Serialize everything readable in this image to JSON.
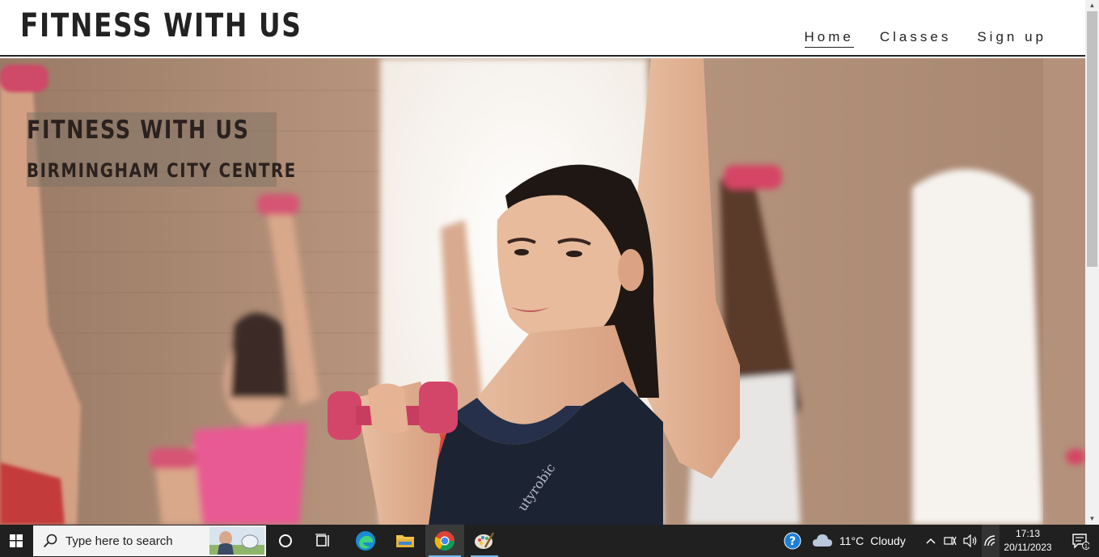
{
  "site": {
    "brand": "FITNESS WITH US",
    "nav": [
      {
        "label": "Home",
        "active": true
      },
      {
        "label": "Classes",
        "active": false
      },
      {
        "label": "Sign up",
        "active": false
      }
    ]
  },
  "hero": {
    "title": "FITNESS WITH US",
    "subtitle": "BIRMINGHAM CITY CENTRE",
    "image": "women-lifting-pink-dumbbells-in-gym-class"
  },
  "taskbar": {
    "search_placeholder": "Type here to search",
    "apps": [
      {
        "name": "cortana-icon"
      },
      {
        "name": "task-view-icon"
      },
      {
        "name": "edge-icon"
      },
      {
        "name": "file-explorer-icon"
      },
      {
        "name": "chrome-icon",
        "active": true
      },
      {
        "name": "paint-icon",
        "active": true
      }
    ],
    "weather": {
      "temp": "11°C",
      "condition": "Cloudy"
    },
    "clock": {
      "time": "17:13",
      "date": "20/11/2023"
    },
    "notification_count": "1"
  },
  "colors": {
    "header_text": "#222222",
    "taskbar_bg": "#202020",
    "active_indicator": "#76b9ed",
    "dumbbell_pink": "#d8506e"
  }
}
